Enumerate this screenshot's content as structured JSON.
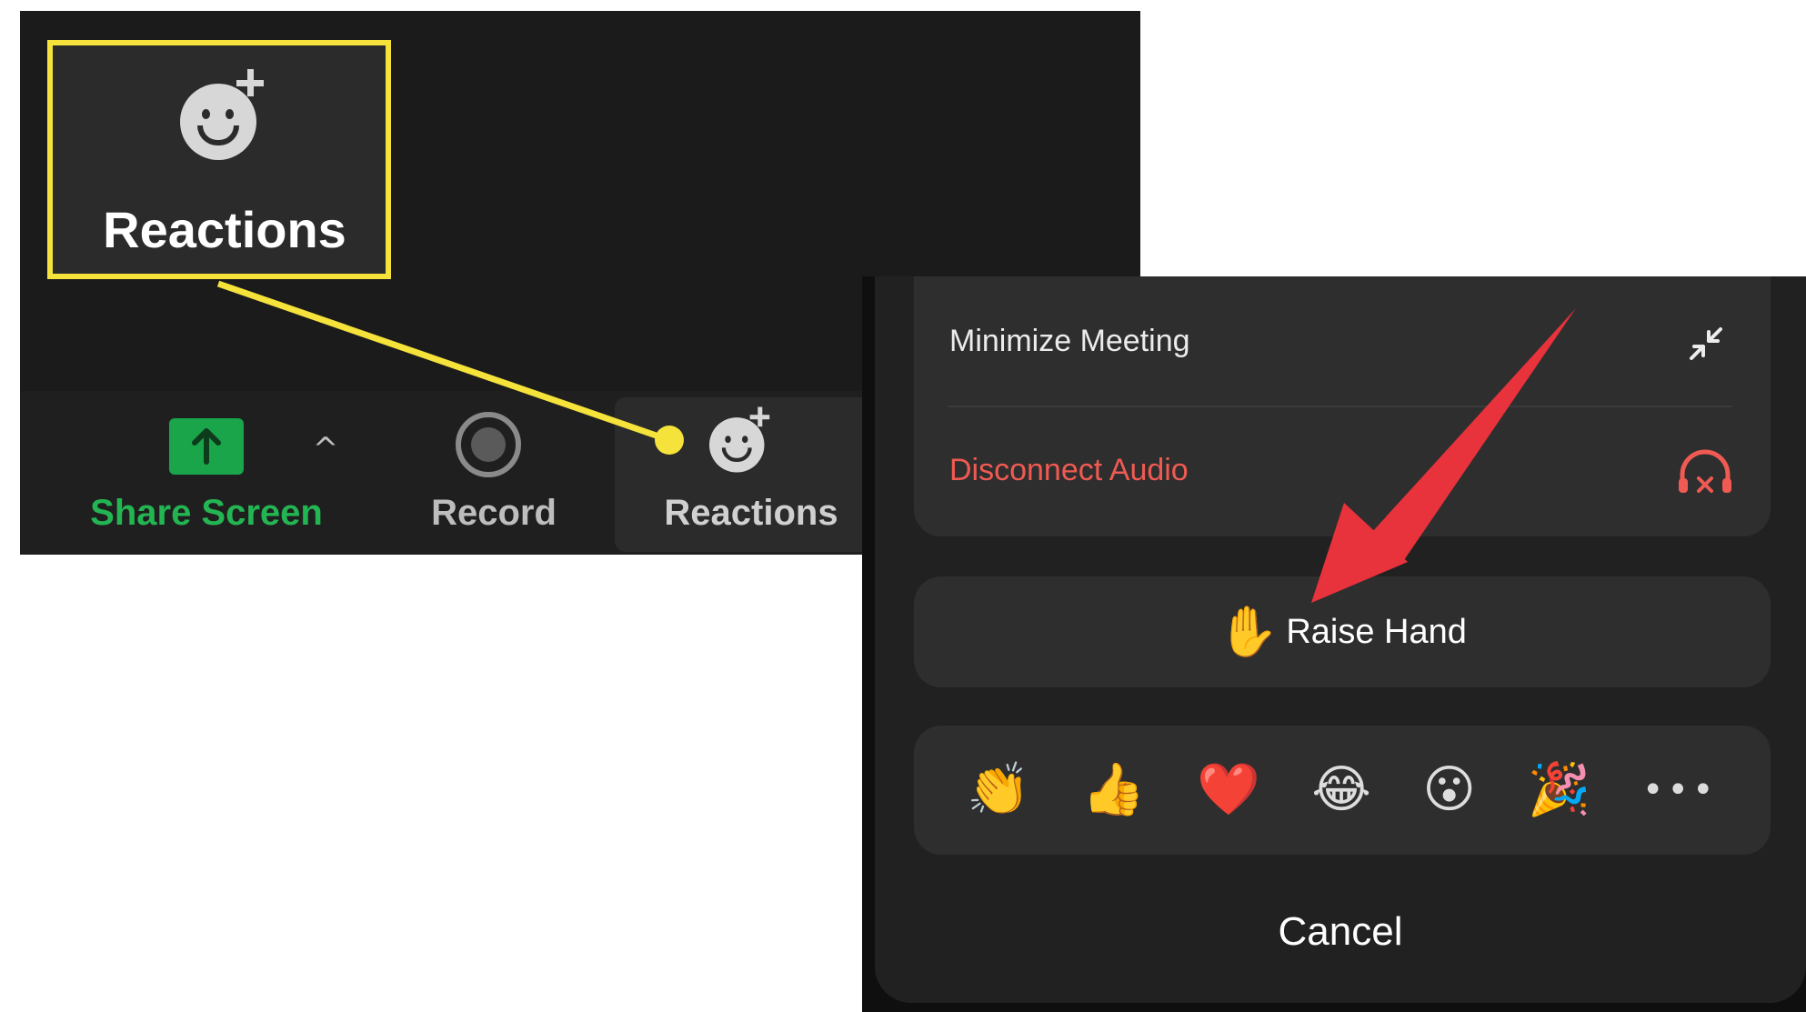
{
  "desktop": {
    "zoom_callout": {
      "label": "Reactions",
      "icon": "smiley-plus-icon"
    },
    "toolbar": {
      "share_screen": {
        "label": "Share Screen",
        "icon": "up-arrow-icon"
      },
      "share_options_caret": "^",
      "record": {
        "label": "Record",
        "icon": "record-icon"
      },
      "reactions": {
        "label": "Reactions",
        "icon": "smiley-plus-icon"
      }
    }
  },
  "mobile_sheet": {
    "menu_items": [
      {
        "label": "Minimize Meeting",
        "icon": "minimize-arrows-icon",
        "color": "#ececec"
      },
      {
        "label": "Disconnect Audio",
        "icon": "headphones-x-icon",
        "color": "#ef5a52"
      }
    ],
    "raise_hand": {
      "emoji": "✋",
      "label": "Raise Hand"
    },
    "emoji_row": [
      "👏",
      "👍",
      "❤️",
      "😂",
      "😮",
      "🎉"
    ],
    "more_label": "•••",
    "cancel_label": "Cancel"
  },
  "colors": {
    "callout_yellow": "#f5e23a",
    "arrow_red": "#e8323c",
    "share_green": "#24b553",
    "danger_red": "#ef5a52"
  }
}
